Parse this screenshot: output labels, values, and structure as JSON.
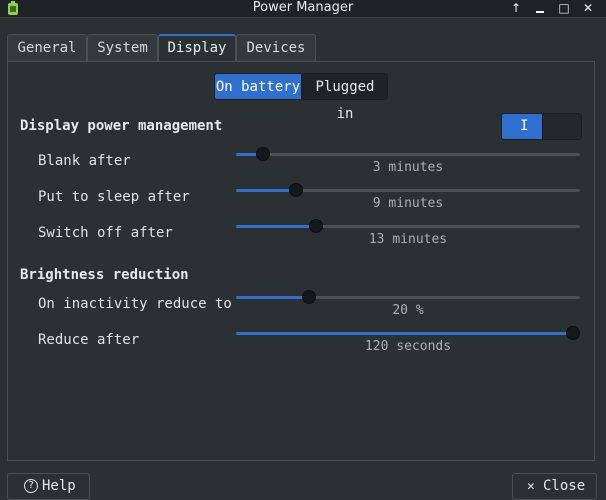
{
  "window": {
    "title": "Power Manager",
    "buttons": {
      "up": "↑",
      "maximize": "□",
      "close": "✕"
    }
  },
  "tabs": [
    {
      "label": "General",
      "active": false
    },
    {
      "label": "System",
      "active": false
    },
    {
      "label": "Display",
      "active": true
    },
    {
      "label": "Devices",
      "active": false
    }
  ],
  "power_source": {
    "selected": "On battery",
    "other": "Plugged in"
  },
  "display_management": {
    "title": "Display power management",
    "toggle_mark": "I",
    "enabled": true,
    "settings": [
      {
        "label": "Blank after",
        "value": "3 minutes",
        "fraction": 0.06
      },
      {
        "label": "Put to sleep after",
        "value": "9 minutes",
        "fraction": 0.16
      },
      {
        "label": "Switch off after",
        "value": "13 minutes",
        "fraction": 0.22
      }
    ]
  },
  "brightness": {
    "title": "Brightness reduction",
    "settings": [
      {
        "label": "On inactivity reduce to",
        "value": "20 %",
        "fraction": 0.2
      },
      {
        "label": "Reduce after",
        "value": "120 seconds",
        "fraction": 1.0
      }
    ]
  },
  "footer": {
    "help_label": "Help",
    "help_icon": "?",
    "close_label": "Close",
    "close_icon": "✕"
  },
  "colors": {
    "accent": "#2f6fcf",
    "background": "#2b3033"
  }
}
